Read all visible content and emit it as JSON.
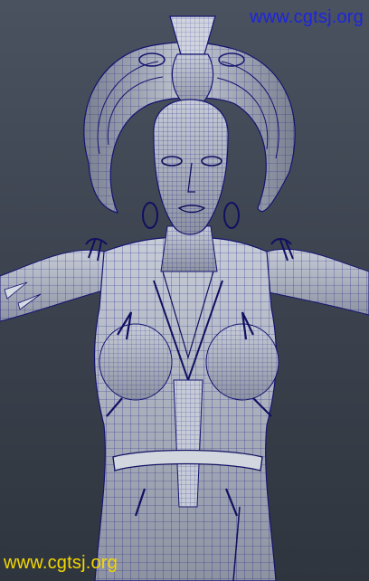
{
  "scene": {
    "subject": "wireframe-character-model",
    "colors": {
      "background_top": "#4a5260",
      "background_bottom": "#2f353e",
      "surface": "#b7bcc8",
      "surface_shadow": "#6f7584",
      "wire": "#1a1a8c"
    }
  },
  "watermarks": {
    "top_text": "www.cgtsj.org",
    "bottom_text": "www.cgtsj.org",
    "top_color": "#1d24e0",
    "bottom_color": "#f5d800"
  }
}
